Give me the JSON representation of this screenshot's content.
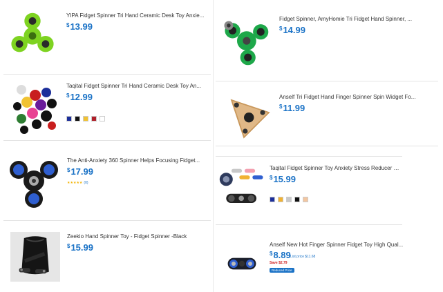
{
  "colors": {
    "price_blue": "#1a72c6",
    "save_red": "#d01f1f",
    "star": "#f3b300"
  },
  "products": [
    {
      "title": "YIPA Fidget Spinner Tri Hand Ceramic Desk Toy Anxie...",
      "price_symbol": "$",
      "price_value": "13.99",
      "image": "lime-green-tri-spinner"
    },
    {
      "title": "Fidget Spinner, AmyHomie Tri Fidget Hand Spinner, ...",
      "price_symbol": "$",
      "price_value": "14.99",
      "image": "green-tri-spinner"
    },
    {
      "title": "Taqital Fidget Spinner Tri Hand Ceramic Desk Toy An...",
      "price_symbol": "$",
      "price_value": "12.99",
      "image": "multicolor-spinner-pile",
      "swatches": [
        "#1c2f9a",
        "#111111",
        "#f1c232",
        "#b0202a",
        "#ffffff"
      ]
    },
    {
      "title": "Anself Tri Fidget Hand Finger Spinner Spin Widget Fo...",
      "price_symbol": "$",
      "price_value": "11.99",
      "image": "wooden-tri-spinner"
    },
    {
      "title": "The Anti-Anxiety 360 Spinner Helps Focusing Fidget...",
      "price_symbol": "$",
      "price_value": "17.99",
      "image": "black-blue-tri-spinner",
      "stars": "★★★★★",
      "review_count": "(0)"
    },
    {
      "title": "Taqital Fidget Spinner Toy Anxiety Stress Reducer Fo...",
      "price_symbol": "$",
      "price_value": "15.99",
      "image": "bar-spinner-set",
      "swatches": [
        "#1c2f9a",
        "#f1b232",
        "#c8c8c8",
        "#111111",
        "#f3c6a0"
      ]
    },
    {
      "title": "Zeekio Hand Spinner Toy - Fidget Spinner -Black",
      "price_symbol": "$",
      "price_value": "15.99",
      "image": "black-pouch-spinner"
    },
    {
      "title": "Anself New Hot Finger Spinner Fidget Toy High Qual...",
      "price_symbol": "$",
      "price_value": "8.89",
      "list_price": "List price $11.68",
      "save": "Save $2.79",
      "badge": "Reduced Price",
      "image": "dual-bar-spinner"
    }
  ]
}
